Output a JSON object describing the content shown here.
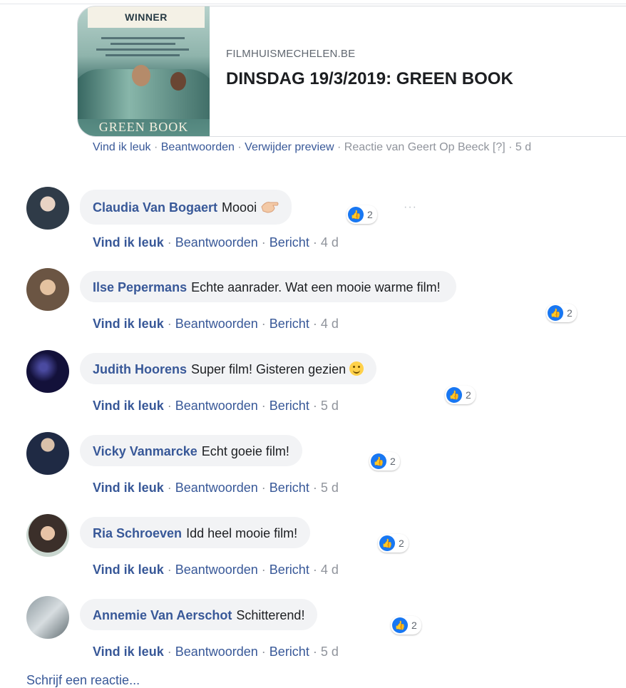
{
  "preview": {
    "poster_banner": "WINNER",
    "poster_title": "GREEN BOOK",
    "domain": "FILMHUISMECHELEN.BE",
    "title": "DINSDAG 19/3/2019: GREEN BOOK",
    "actions": {
      "like": "Vind ik leuk",
      "reply": "Beantwoorden",
      "remove": "Verwijder preview",
      "reaction_by": "Reactie van Geert Op Beeck",
      "flag": "[?]",
      "time": "5 d"
    }
  },
  "comments": [
    {
      "author": "Claudia Van Bogaert",
      "text": "Moooi",
      "emoji": "thumb-hand",
      "likes": "2",
      "like": "Vind ik leuk",
      "reply": "Beantwoorden",
      "message": "Bericht",
      "time": "4 d"
    },
    {
      "author": "Ilse Pepermans",
      "text": "Echte aanrader. Wat een mooie warme film!",
      "likes": "2",
      "like": "Vind ik leuk",
      "reply": "Beantwoorden",
      "message": "Bericht",
      "time": "4 d"
    },
    {
      "author": "Judith Hoorens",
      "text": "Super film! Gisteren gezien",
      "emoji": "smile",
      "likes": "2",
      "like": "Vind ik leuk",
      "reply": "Beantwoorden",
      "message": "Bericht",
      "time": "5 d"
    },
    {
      "author": "Vicky Vanmarcke",
      "text": "Echt goeie film!",
      "likes": "2",
      "like": "Vind ik leuk",
      "reply": "Beantwoorden",
      "message": "Bericht",
      "time": "5 d"
    },
    {
      "author": "Ria Schroeven",
      "text": "Idd heel mooie film!",
      "likes": "2",
      "like": "Vind ik leuk",
      "reply": "Beantwoorden",
      "message": "Bericht",
      "time": "4 d"
    },
    {
      "author": "Annemie Van Aerschot",
      "text": "Schitterend!",
      "likes": "2",
      "like": "Vind ik leuk",
      "reply": "Beantwoorden",
      "message": "Bericht",
      "time": "5 d"
    }
  ],
  "write_comment": "Schrijf een reactie...",
  "colors": {
    "link": "#385898",
    "bubble": "#f2f3f5",
    "like_blue": "#1877f2"
  }
}
